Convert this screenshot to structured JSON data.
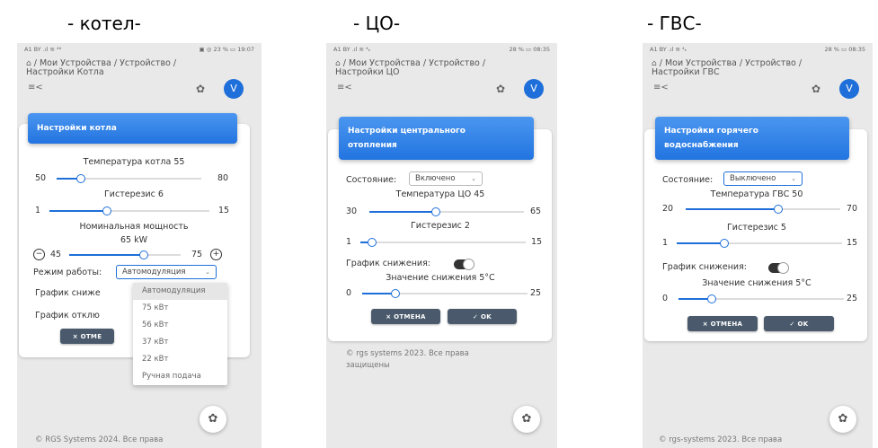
{
  "captions": [
    "- котел-",
    "- ЦО-",
    "- ГВС-"
  ],
  "common": {
    "avatar_letter": "V",
    "menu_icon_glyph": "≡<",
    "gear_glyph": "✿",
    "home_glyph": "⌂",
    "cancel_label": "× ОТМЕНА",
    "ok_label": "✓ OK"
  },
  "screen1": {
    "status_left": "A1 BY  .ıl ≋ ⁴⁶",
    "status_right": "▣ ◎ 23 % ▭ 19:07",
    "breadcrumb1": "/ Мои Устройства / Устройство /",
    "breadcrumb2": "Настройки Котла",
    "card_title": "Настройки котла",
    "temp_label": "Температура котла 55",
    "temp": {
      "min": "50",
      "max": "80",
      "value": 55
    },
    "hyst_label": "Гистерезис 6",
    "hyst": {
      "min": "1",
      "max": "15",
      "value": 6
    },
    "power_label": "Номинальная мощность",
    "power_value": "65 kW",
    "power": {
      "min": "45",
      "max": "75",
      "value": 65
    },
    "mode_label": "Режим работы:",
    "mode_value": "Автомодуляция",
    "graph_lower_label": "График сниже",
    "graph_off_label": "График отклю",
    "cancel_partial": "× ОТМЕ",
    "dropdown_options": [
      "Автомодуляция",
      "75 кВт",
      "56 кВт",
      "37 кВт",
      "22 кВт",
      "Ручная подача"
    ],
    "footer": "© RGS Systems 2024. Все права"
  },
  "screen2": {
    "status_left": "A1 BY .ıl ≋ ⁴ₖ",
    "status_right": "28 % ▭ 08:35",
    "breadcrumb1": "/ Мои Устройства / Устройство /",
    "breadcrumb2": "Настройки ЦО",
    "card_title_1": "Настройки центрального",
    "card_title_2": "отопления",
    "state_label": "Состояние:",
    "state_value": "Включено",
    "temp_label": "Температура ЦО 45",
    "temp": {
      "min": "30",
      "max": "65",
      "value": 45
    },
    "hyst_label": "Гистерезис 2",
    "hyst": {
      "min": "1",
      "max": "15",
      "value": 2
    },
    "graph_label": "График снижения:",
    "reduce_label": "Значение снижения 5°С",
    "reduce": {
      "min": "0",
      "max": "25",
      "value": 5
    },
    "footer1": "© rgs systems 2023. Все права",
    "footer2": "защищены"
  },
  "screen3": {
    "status_left": "A1 BY .ıl ≋ ⁴ₖ",
    "status_right": "28 % ▭ 08:35",
    "breadcrumb1": "/ Мои Устройства / Устройство /",
    "breadcrumb2": "Настройки ГВС",
    "card_title_1": "Настройки горячего",
    "card_title_2": "водоснабжения",
    "state_label": "Состояние:",
    "state_value": "Выключено",
    "temp_label": "Температура ГВС 50",
    "temp": {
      "min": "20",
      "max": "70",
      "value": 50
    },
    "hyst_label": "Гистерезис 5",
    "hyst": {
      "min": "1",
      "max": "15",
      "value": 5
    },
    "graph_label": "График снижения:",
    "reduce_label": "Значение снижения 5°С",
    "reduce": {
      "min": "0",
      "max": "25",
      "value": 5
    },
    "footer": "© rgs-systems 2023. Все права"
  }
}
